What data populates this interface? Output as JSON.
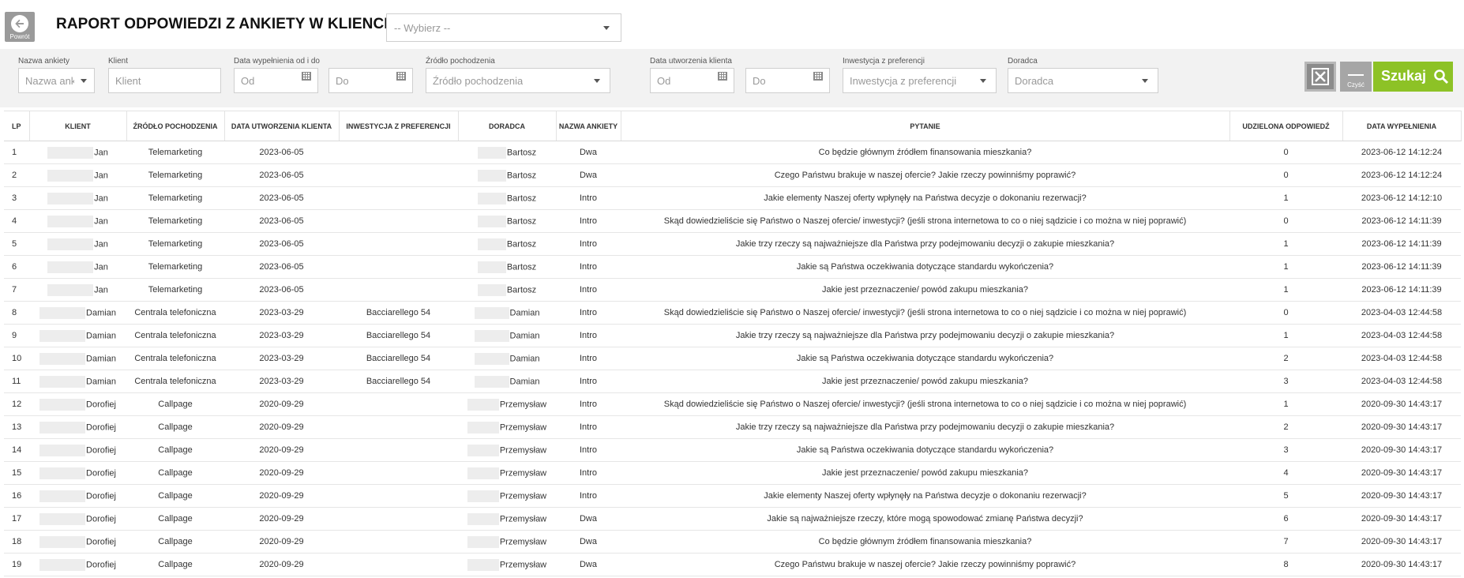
{
  "header": {
    "back_label": "Powrót",
    "title": "RAPORT ODPOWIEDZI Z ANKIETY W KLIENCIE",
    "survey_select": "-- Wybierz --"
  },
  "filters": {
    "survey_name_label": "Nazwa ankiety",
    "survey_name_placeholder": "Nazwa ankiety",
    "client_label": "Klient",
    "client_placeholder": "Klient",
    "fill_date_label": "Data wypełnienia od i do",
    "fill_date_from": "Od",
    "fill_date_to": "Do",
    "source_label": "Źródło pochodzenia",
    "source_placeholder": "Źródło pochodzenia",
    "client_created_label": "Data utworzenia klienta",
    "client_created_from": "Od",
    "client_created_to": "Do",
    "investment_label": "Inwestycja z preferencji",
    "investment_placeholder": "Inwestycja z preferencji",
    "advisor_label": "Doradca",
    "advisor_placeholder": "Doradca",
    "clear_label": "Czyść",
    "search_label": "Szukaj"
  },
  "table": {
    "columns": [
      "LP",
      "KLIENT",
      "ŹRÓDŁO POCHODZENIA",
      "DATA UTWORZENIA KLIENTA",
      "INWESTYCJA Z PREFERENCJI",
      "DORADCA",
      "NAZWA ANKIETY",
      "PYTANIE",
      "UDZIELONA ODPOWIEDŹ",
      "DATA WYPEŁNIENIA"
    ],
    "rows": [
      {
        "lp": "1",
        "client": "Jan",
        "source": "Telemarketing",
        "created": "2023-06-05",
        "investment": "",
        "advisor": "Bartosz",
        "survey": "Dwa",
        "question": "Co będzie głównym źródłem finansowania mieszkania?",
        "answer": "0",
        "filled": "2023-06-12 14:12:24"
      },
      {
        "lp": "2",
        "client": "Jan",
        "source": "Telemarketing",
        "created": "2023-06-05",
        "investment": "",
        "advisor": "Bartosz",
        "survey": "Dwa",
        "question": "Czego Państwu brakuje w naszej ofercie? Jakie rzeczy powinniśmy poprawić?",
        "answer": "0",
        "filled": "2023-06-12 14:12:24"
      },
      {
        "lp": "3",
        "client": "Jan",
        "source": "Telemarketing",
        "created": "2023-06-05",
        "investment": "",
        "advisor": "Bartosz",
        "survey": "Intro",
        "question": "Jakie elementy Naszej oferty wpłynęły na Państwa decyzje o dokonaniu rezerwacji?",
        "answer": "1",
        "filled": "2023-06-12 14:12:10"
      },
      {
        "lp": "4",
        "client": "Jan",
        "source": "Telemarketing",
        "created": "2023-06-05",
        "investment": "",
        "advisor": "Bartosz",
        "survey": "Intro",
        "question": "Skąd dowiedzieliście się Państwo o Naszej ofercie/ inwestycji? (jeśli strona internetowa to co o niej sądzicie i co można w niej poprawić)",
        "answer": "0",
        "filled": "2023-06-12 14:11:39"
      },
      {
        "lp": "5",
        "client": "Jan",
        "source": "Telemarketing",
        "created": "2023-06-05",
        "investment": "",
        "advisor": "Bartosz",
        "survey": "Intro",
        "question": "Jakie trzy rzeczy są najważniejsze dla Państwa przy podejmowaniu decyzji o zakupie mieszkania?",
        "answer": "1",
        "filled": "2023-06-12 14:11:39"
      },
      {
        "lp": "6",
        "client": "Jan",
        "source": "Telemarketing",
        "created": "2023-06-05",
        "investment": "",
        "advisor": "Bartosz",
        "survey": "Intro",
        "question": "Jakie są Państwa oczekiwania dotyczące standardu wykończenia?",
        "answer": "1",
        "filled": "2023-06-12 14:11:39"
      },
      {
        "lp": "7",
        "client": "Jan",
        "source": "Telemarketing",
        "created": "2023-06-05",
        "investment": "",
        "advisor": "Bartosz",
        "survey": "Intro",
        "question": "Jakie jest przeznaczenie/ powód zakupu mieszkania?",
        "answer": "1",
        "filled": "2023-06-12 14:11:39"
      },
      {
        "lp": "8",
        "client": "Damian",
        "source": "Centrala telefoniczna",
        "created": "2023-03-29",
        "investment": "Bacciarellego 54",
        "advisor": "Damian",
        "survey": "Intro",
        "question": "Skąd dowiedzieliście się Państwo o Naszej ofercie/ inwestycji? (jeśli strona internetowa to co o niej sądzicie i co można w niej poprawić)",
        "answer": "0",
        "filled": "2023-04-03 12:44:58"
      },
      {
        "lp": "9",
        "client": "Damian",
        "source": "Centrala telefoniczna",
        "created": "2023-03-29",
        "investment": "Bacciarellego 54",
        "advisor": "Damian",
        "survey": "Intro",
        "question": "Jakie trzy rzeczy są najważniejsze dla Państwa przy podejmowaniu decyzji o zakupie mieszkania?",
        "answer": "1",
        "filled": "2023-04-03 12:44:58"
      },
      {
        "lp": "10",
        "client": "Damian",
        "source": "Centrala telefoniczna",
        "created": "2023-03-29",
        "investment": "Bacciarellego 54",
        "advisor": "Damian",
        "survey": "Intro",
        "question": "Jakie są Państwa oczekiwania dotyczące standardu wykończenia?",
        "answer": "2",
        "filled": "2023-04-03 12:44:58"
      },
      {
        "lp": "11",
        "client": "Damian",
        "source": "Centrala telefoniczna",
        "created": "2023-03-29",
        "investment": "Bacciarellego 54",
        "advisor": "Damian",
        "survey": "Intro",
        "question": "Jakie jest przeznaczenie/ powód zakupu mieszkania?",
        "answer": "3",
        "filled": "2023-04-03 12:44:58"
      },
      {
        "lp": "12",
        "client": "Dorofiej",
        "source": "Callpage",
        "created": "2020-09-29",
        "investment": "",
        "advisor": "Przemysław",
        "survey": "Intro",
        "question": "Skąd dowiedzieliście się Państwo o Naszej ofercie/ inwestycji? (jeśli strona internetowa to co o niej sądzicie i co można w niej poprawić)",
        "answer": "1",
        "filled": "2020-09-30 14:43:17"
      },
      {
        "lp": "13",
        "client": "Dorofiej",
        "source": "Callpage",
        "created": "2020-09-29",
        "investment": "",
        "advisor": "Przemysław",
        "survey": "Intro",
        "question": "Jakie trzy rzeczy są najważniejsze dla Państwa przy podejmowaniu decyzji o zakupie mieszkania?",
        "answer": "2",
        "filled": "2020-09-30 14:43:17"
      },
      {
        "lp": "14",
        "client": "Dorofiej",
        "source": "Callpage",
        "created": "2020-09-29",
        "investment": "",
        "advisor": "Przemysław",
        "survey": "Intro",
        "question": "Jakie są Państwa oczekiwania dotyczące standardu wykończenia?",
        "answer": "3",
        "filled": "2020-09-30 14:43:17"
      },
      {
        "lp": "15",
        "client": "Dorofiej",
        "source": "Callpage",
        "created": "2020-09-29",
        "investment": "",
        "advisor": "Przemysław",
        "survey": "Intro",
        "question": "Jakie jest przeznaczenie/ powód zakupu mieszkania?",
        "answer": "4",
        "filled": "2020-09-30 14:43:17"
      },
      {
        "lp": "16",
        "client": "Dorofiej",
        "source": "Callpage",
        "created": "2020-09-29",
        "investment": "",
        "advisor": "Przemysław",
        "survey": "Intro",
        "question": "Jakie elementy Naszej oferty wpłynęły na Państwa decyzje o dokonaniu rezerwacji?",
        "answer": "5",
        "filled": "2020-09-30 14:43:17"
      },
      {
        "lp": "17",
        "client": "Dorofiej",
        "source": "Callpage",
        "created": "2020-09-29",
        "investment": "",
        "advisor": "Przemysław",
        "survey": "Dwa",
        "question": "Jakie są najważniejsze rzeczy, które mogą spowodować zmianę Państwa decyzji?",
        "answer": "6",
        "filled": "2020-09-30 14:43:17"
      },
      {
        "lp": "18",
        "client": "Dorofiej",
        "source": "Callpage",
        "created": "2020-09-29",
        "investment": "",
        "advisor": "Przemysław",
        "survey": "Dwa",
        "question": "Co będzie głównym źródłem finansowania mieszkania?",
        "answer": "7",
        "filled": "2020-09-30 14:43:17"
      },
      {
        "lp": "19",
        "client": "Dorofiej",
        "source": "Callpage",
        "created": "2020-09-29",
        "investment": "",
        "advisor": "Przemysław",
        "survey": "Dwa",
        "question": "Czego Państwu brakuje w naszej ofercie? Jakie rzeczy powinniśmy poprawić?",
        "answer": "8",
        "filled": "2020-09-30 14:43:17"
      }
    ]
  }
}
